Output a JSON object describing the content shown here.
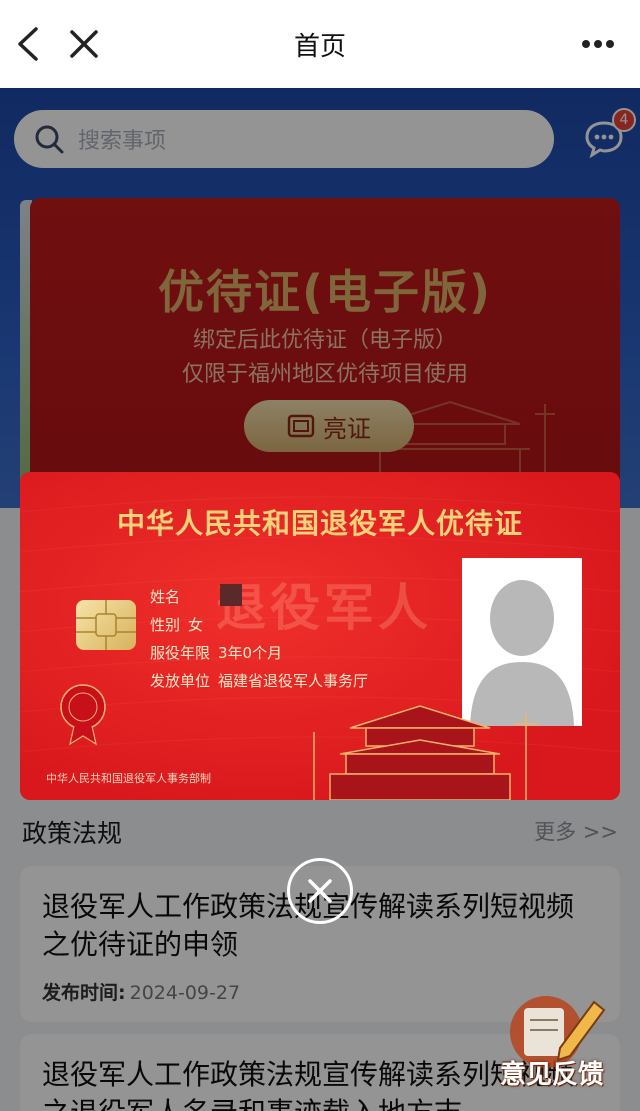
{
  "nav": {
    "title": "首页",
    "back_icon": "chevron-left-icon",
    "close_icon": "close-icon",
    "more_icon": "more-dots-icon"
  },
  "search": {
    "placeholder": "搜索事项"
  },
  "messages": {
    "badge_count": "4"
  },
  "banner_card": {
    "title": "优待证(电子版)",
    "line1": "绑定后此优待证（电子版）",
    "line2": "仅限于福州地区优待项目使用",
    "button_label": "亮证"
  },
  "certificate": {
    "title": "中华人民共和国退役军人优待证",
    "watermark": "退役军人",
    "name_label": "姓名",
    "gender_label": "性别",
    "gender_value": "女",
    "service_label": "服役年限",
    "service_value": "3年0个月",
    "issuer_label": "发放单位",
    "issuer_value": "福建省退役军人事务厅",
    "footer": "中华人民共和国退役军人事务部制"
  },
  "policy": {
    "section_title": "政策法规",
    "more_label": "更多 >>",
    "articles": [
      {
        "title": "退役军人工作政策法规宣传解读系列短视频之优待证的申领",
        "date_label": "发布时间:",
        "date": "2024-09-27"
      },
      {
        "title": "退役军人工作政策法规宣传解读系列短视频之退役军人名录和事迹载入地方志"
      }
    ]
  },
  "feedback": {
    "label": "意见反馈"
  },
  "colors": {
    "brand_blue": "#2c5fc4",
    "card_red": "#d8181c",
    "gold": "#f6d27a"
  }
}
